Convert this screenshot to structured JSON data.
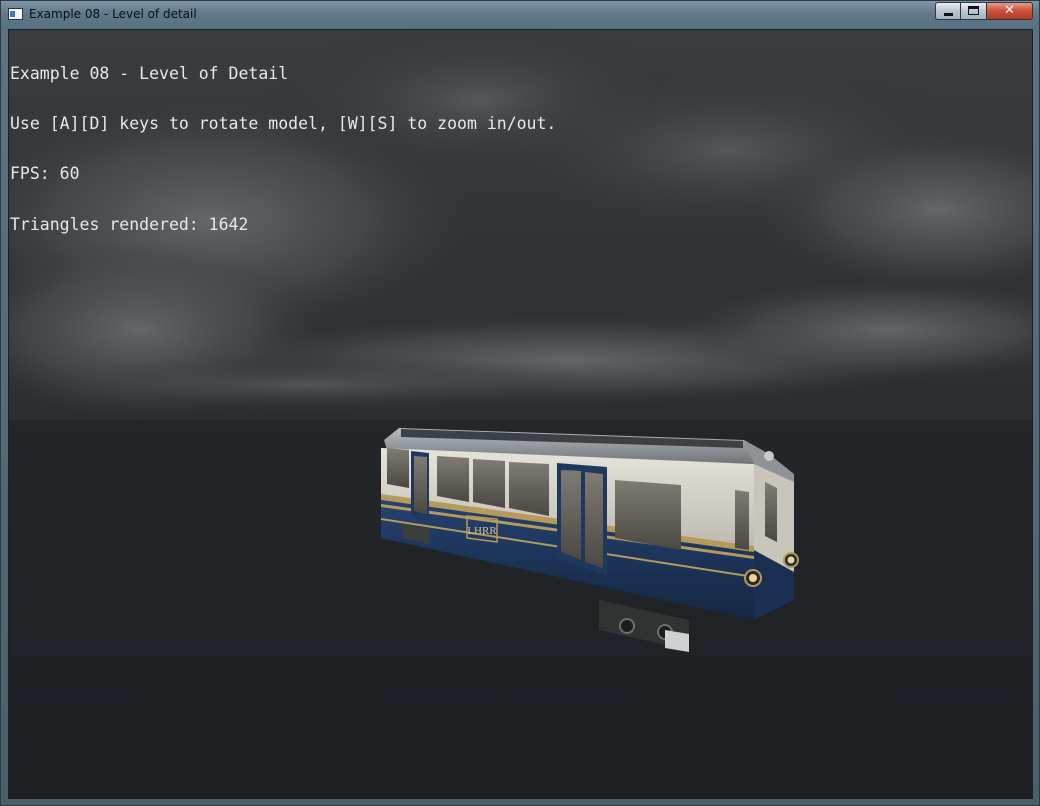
{
  "window": {
    "title": "Example 08 - Level of detail",
    "close_glyph": "✕"
  },
  "hud": {
    "line1": "Example 08 - Level of Detail",
    "line2": "Use [A][D] keys to rotate model, [W][S] to zoom in/out.",
    "line3": "FPS: 60",
    "line4": "Triangles rendered: 1642"
  },
  "model": {
    "emblem": "LHRR"
  },
  "icons": {
    "app": "app-window-icon",
    "minimize": "minimize-icon",
    "maximize": "maximize-icon",
    "close": "close-icon"
  },
  "colors": {
    "hud_text": "#e8e8e8",
    "tram_blue": "#1d3358",
    "tram_cream": "#d9d6cc",
    "trim_gold": "#b69a5a",
    "sky_dark": "#26292c"
  }
}
